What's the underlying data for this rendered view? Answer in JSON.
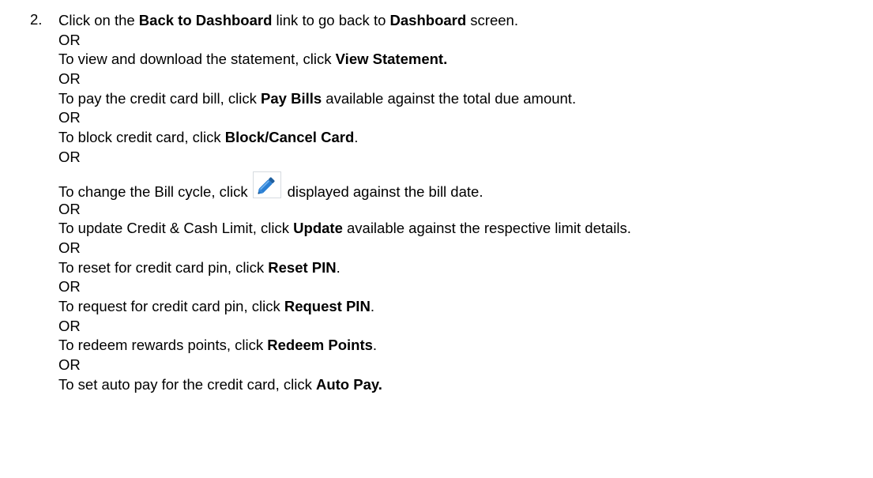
{
  "step_number": "2.",
  "lines": {
    "l1_pre": "Click on the ",
    "l1_b1": "Back to Dashboard",
    "l1_mid": " link to go back to ",
    "l1_b2": "Dashboard",
    "l1_post": " screen.",
    "or1": "OR",
    "l2_pre": "To view and download the statement, click ",
    "l2_b": "View Statement.",
    "or2": "OR",
    "l3_pre": "To pay the credit card bill, click ",
    "l3_b": "Pay Bills",
    "l3_post": " available against the total due amount.",
    "or3": "OR",
    "l4_pre": "To block credit card, click ",
    "l4_b": "Block/Cancel Card",
    "l4_post": ".",
    "or4": "OR",
    "l5_pre": "To change the Bill cycle, click",
    "l5_post": "displayed against the bill date.",
    "or5": "OR",
    "l6_pre": "To update Credit & Cash Limit, click ",
    "l6_b": "Update",
    "l6_post": " available against the respective limit details.",
    "or6": "OR",
    "l7_pre": "To reset for credit card pin, click ",
    "l7_b": "Reset PIN",
    "l7_post": ".",
    "or7": "OR",
    "l8_pre": "To request for credit card pin, click ",
    "l8_b": "Request PIN",
    "l8_post": ".",
    "or8": "OR",
    "l9_pre": "To redeem rewards points, click ",
    "l9_b": "Redeem Points",
    "l9_post": ".",
    "or9": "OR",
    "l10_pre": "To set auto pay for the credit card, click ",
    "l10_b": "Auto Pay."
  },
  "icons": {
    "edit": "pencil-edit-icon"
  },
  "colors": {
    "text": "#000000",
    "icon_blue": "#2a7fd4",
    "icon_border": "#d6dbe0"
  }
}
